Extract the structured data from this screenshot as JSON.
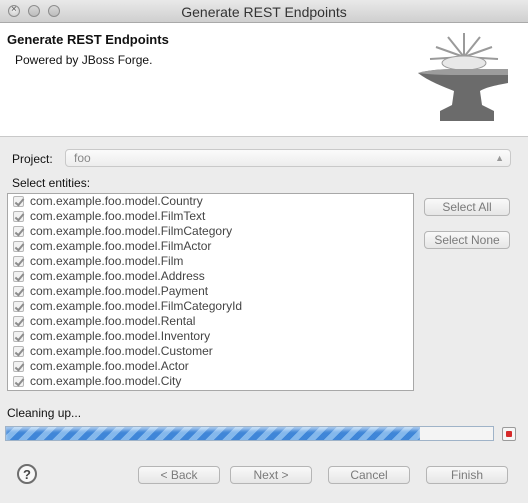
{
  "window": {
    "title": "Generate REST Endpoints"
  },
  "banner": {
    "title": "Generate REST Endpoints",
    "subtitle": "Powered by JBoss Forge.",
    "logo_icon": "anvil-icon"
  },
  "project": {
    "label": "Project:",
    "value": "foo"
  },
  "entities": {
    "label": "Select entities:",
    "items": [
      "com.example.foo.model.Country",
      "com.example.foo.model.FilmText",
      "com.example.foo.model.FilmCategory",
      "com.example.foo.model.FilmActor",
      "com.example.foo.model.Film",
      "com.example.foo.model.Address",
      "com.example.foo.model.Payment",
      "com.example.foo.model.FilmCategoryId",
      "com.example.foo.model.Rental",
      "com.example.foo.model.Inventory",
      "com.example.foo.model.Customer",
      "com.example.foo.model.Actor",
      "com.example.foo.model.City"
    ],
    "all_checked": true
  },
  "buttons": {
    "select_all": "Select All",
    "select_none": "Select None",
    "back": "< Back",
    "next": "Next >",
    "cancel": "Cancel",
    "finish": "Finish"
  },
  "status": {
    "text": "Cleaning up...",
    "progress": 0.85
  },
  "help": {
    "label": "?"
  }
}
